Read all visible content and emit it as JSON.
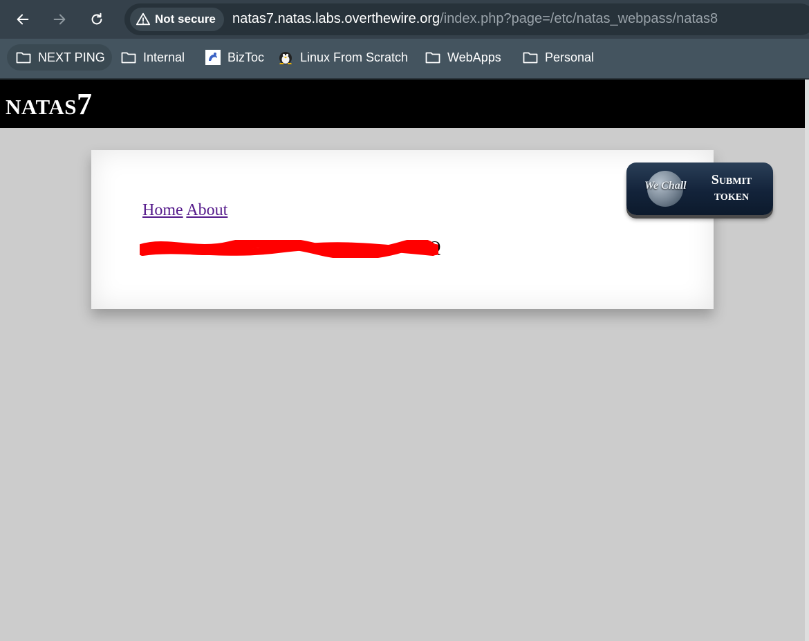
{
  "browser": {
    "security_label": "Not secure",
    "url_host": "natas7.natas.labs.overthewire.org",
    "url_path": "/index.php?page=/etc/natas_webpass/natas8",
    "bookmarks": [
      {
        "label": "NEXT PING",
        "icon": "folder-icon"
      },
      {
        "label": "Internal",
        "icon": "folder-icon"
      },
      {
        "label": "BizToc",
        "icon": "biztoc-icon"
      },
      {
        "label": "Linux From Scratch",
        "icon": "tux-icon"
      },
      {
        "label": "WebApps",
        "icon": "folder-icon"
      },
      {
        "label": "Personal",
        "icon": "folder-icon"
      }
    ]
  },
  "page": {
    "title": "natas7",
    "nav": {
      "home": "Home",
      "about": "About"
    },
    "secret_visible_tail": "5Q",
    "redaction_color": "#ff0000"
  },
  "wechall": {
    "brand": "We Chall",
    "button_label_line1": "Submit",
    "button_label_line2": "token"
  }
}
